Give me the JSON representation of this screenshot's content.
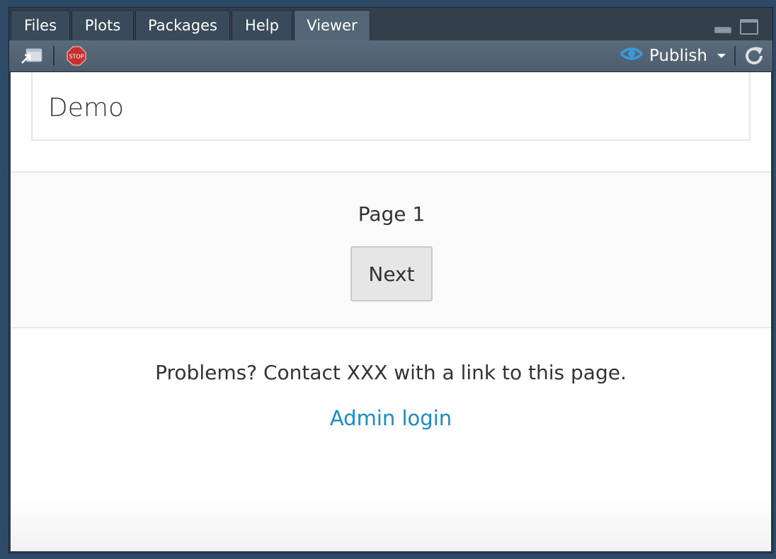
{
  "tabs": [
    {
      "label": "Files"
    },
    {
      "label": "Plots"
    },
    {
      "label": "Packages"
    },
    {
      "label": "Help"
    },
    {
      "label": "Viewer",
      "active": true
    }
  ],
  "toolbar": {
    "icons": [
      "show-in-new-window-icon",
      "stop-icon",
      "publish-icon",
      "refresh-icon"
    ],
    "publish_label": "Publish"
  },
  "viewer": {
    "title": "Demo",
    "page_label": "Page 1",
    "next_label": "Next",
    "footer_text": "Problems? Contact XXX with a link to this page.",
    "admin_link": "Admin login"
  },
  "colors": {
    "link": "#1c8bc4",
    "publish_icon": "#3a9ad9",
    "stop_icon": "#c8302f"
  }
}
